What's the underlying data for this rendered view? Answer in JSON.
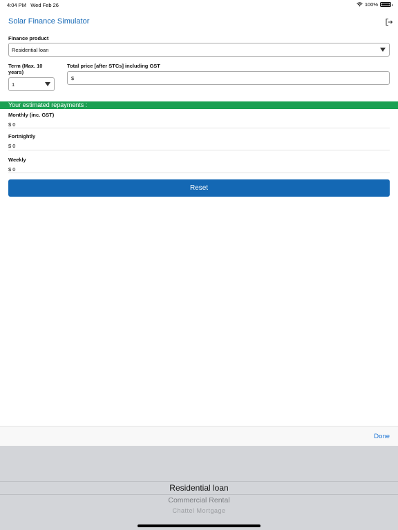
{
  "status": {
    "time": "4:04 PM",
    "date": "Wed Feb 26",
    "battery": "100%",
    "battery_level": 1.0
  },
  "header": {
    "title": "Solar Finance Simulator",
    "logout_icon": "logout-icon"
  },
  "form": {
    "product_label": "Finance product",
    "product_value": "Residential loan",
    "term_label": "Term (Max. 10 years)",
    "term_value": "1",
    "price_label": "Total price [after STCs] including GST",
    "price_prefix": "$"
  },
  "results": {
    "banner": "Your estimated repayments :",
    "items": [
      {
        "label": "Monthly (inc. GST)",
        "value": "$ 0"
      },
      {
        "label": "Fortnightly",
        "value": "$ 0"
      },
      {
        "label": "Weekly",
        "value": "$ 0"
      }
    ]
  },
  "reset_label": "Reset",
  "picker": {
    "done_label": "Done",
    "options": [
      "Residential loan",
      "Commercial Rental",
      "Chattel Mortgage"
    ],
    "selected": "Residential loan"
  },
  "colors": {
    "accent": "#1769b5",
    "banner": "#1aa052",
    "button": "#1468b4"
  }
}
